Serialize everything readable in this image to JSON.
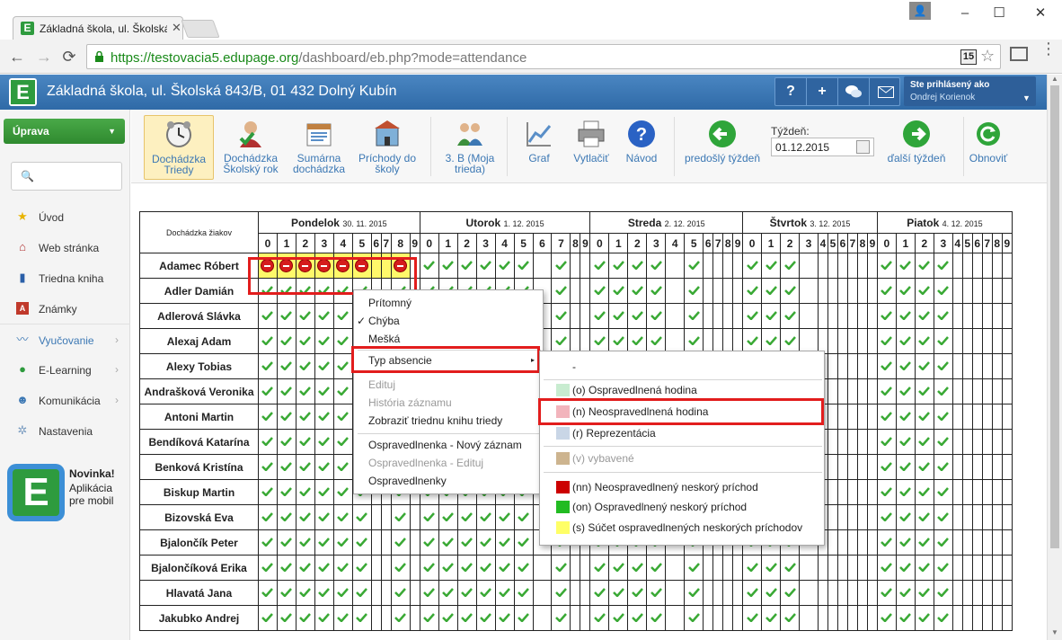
{
  "browser": {
    "tab_title": "Základná škola, ul. Školská",
    "favicon": "E",
    "url_scheme": "https://",
    "url_host": "testovacia5.edupage.org",
    "url_path": "/dashboard/eb.php?mode=attendance",
    "extension_badge": "15",
    "window_controls": [
      "–",
      "☐",
      "✕"
    ]
  },
  "app": {
    "logo": "E",
    "school_name": "Základná škola, ul. Školská 843/B, 01 432 Dolný Kubín",
    "header_buttons": [
      "?",
      "+",
      "",
      ""
    ],
    "user_label": "Ste prihlásený ako",
    "user_name": "Ondrej Korienok"
  },
  "sidebar": {
    "action_button": "Úprava",
    "search_placeholder": "",
    "items": [
      {
        "label": "Úvod",
        "icon": "star-icon",
        "group": false
      },
      {
        "label": "Web stránka",
        "icon": "web-icon",
        "group": false
      },
      {
        "label": "Triedna kniha",
        "icon": "book-icon",
        "group": false
      },
      {
        "label": "Známky",
        "icon": "grades-icon",
        "group": false
      },
      {
        "label": "Vyučovanie",
        "icon": "teaching-icon",
        "group": true
      },
      {
        "label": "E-Learning",
        "icon": "elearning-icon",
        "group": true
      },
      {
        "label": "Komunikácia",
        "icon": "communication-icon",
        "group": true
      },
      {
        "label": "Nastavenia",
        "icon": "settings-icon",
        "group": false
      }
    ],
    "promo_title": "Novinka!",
    "promo_text": "Aplikácia pre mobil"
  },
  "ribbon": {
    "buttons": [
      {
        "label": "Dochádzka Triedy",
        "icon": "clock-icon",
        "active": true
      },
      {
        "label": "Dochádzka Školský rok",
        "icon": "person-check-icon",
        "active": false
      },
      {
        "label": "Sumárna dochádzka",
        "icon": "summary-icon",
        "active": false
      },
      {
        "label": "Príchody do školy",
        "icon": "arrivals-icon",
        "active": false
      },
      {
        "label": "3. B (Moja trieda)",
        "icon": "class-icon",
        "active": false
      },
      {
        "label": "Graf",
        "icon": "chart-icon",
        "active": false
      },
      {
        "label": "Vytlačiť",
        "icon": "print-icon",
        "active": false
      },
      {
        "label": "Návod",
        "icon": "help-icon",
        "active": false
      },
      {
        "label": "predošlý týždeň",
        "icon": "arrow-left-icon",
        "active": false
      },
      {
        "label": "ďalší týždeň",
        "icon": "arrow-right-icon",
        "active": false
      },
      {
        "label": "Obnoviť",
        "icon": "refresh-icon",
        "active": false
      }
    ],
    "week_label": "Týždeň:",
    "week_value": "01.12.2015"
  },
  "attendance": {
    "corner_label": "Dochádzka žiakov",
    "days": [
      {
        "name": "Pondelok",
        "date": "30. 11. 2015",
        "lessons": [
          "0",
          "1",
          "2",
          "3",
          "4",
          "5",
          "6",
          "7",
          "8",
          "9"
        ]
      },
      {
        "name": "Utorok",
        "date": "1. 12. 2015",
        "lessons": [
          "0",
          "1",
          "2",
          "3",
          "4",
          "5",
          "6",
          "7",
          "8",
          "9"
        ]
      },
      {
        "name": "Streda",
        "date": "2. 12. 2015",
        "lessons": [
          "0",
          "1",
          "2",
          "3",
          "4",
          "5",
          "6",
          "7",
          "8",
          "9"
        ]
      },
      {
        "name": "Štvrtok",
        "date": "3. 12. 2015",
        "lessons": [
          "0",
          "1",
          "2",
          "3",
          "4",
          "5",
          "6",
          "7",
          "8",
          "9"
        ]
      },
      {
        "name": "Piatok",
        "date": "4. 12. 2015",
        "lessons": [
          "0",
          "1",
          "2",
          "3",
          "4",
          "5",
          "6",
          "7",
          "8",
          "9"
        ]
      }
    ],
    "students": [
      "Adamec Róbert",
      "Adler Damián",
      "Adlerová Slávka",
      "Alexaj Adam",
      "Alexy Tobias",
      "Andrašková Veronika",
      "Antoni Martin",
      "Bendíková Katarína",
      "Benková Kristína",
      "Biskup Martin",
      "Bizovská Eva",
      "Bjalončík Peter",
      "Bjalončíková Erika",
      "Hlavatá Jana",
      "Jakubko Andrej"
    ]
  },
  "context_menu": {
    "items": [
      {
        "label": "Prítomný",
        "checked": false,
        "disabled": false
      },
      {
        "label": "Chýba",
        "checked": true,
        "disabled": false
      },
      {
        "label": "Mešká",
        "checked": false,
        "disabled": false
      },
      {
        "label": "Typ absencie",
        "checked": false,
        "disabled": false,
        "submenu": true
      },
      {
        "label": "Edituj",
        "checked": false,
        "disabled": true
      },
      {
        "label": "História záznamu",
        "checked": false,
        "disabled": true
      },
      {
        "label": "Zobraziť triednu knihu triedy",
        "checked": false,
        "disabled": false
      },
      {
        "label": "Ospravedlnenka - Nový záznam",
        "checked": false,
        "disabled": false
      },
      {
        "label": "Ospravedlnenka - Edituj",
        "checked": false,
        "disabled": true
      },
      {
        "label": "Ospravedlnenky",
        "checked": false,
        "disabled": false
      }
    ],
    "check_glyph": "✓",
    "submenu_arrow": "▸"
  },
  "absence_submenu": {
    "items": [
      {
        "label": "-",
        "color": "",
        "disabled": false
      },
      {
        "label": "(o) Ospravedlnená hodina",
        "color": "#c8ecd0",
        "disabled": false
      },
      {
        "label": "(n) Neospravedlnená hodina",
        "color": "#f2b4bc",
        "disabled": false
      },
      {
        "label": "(r) Reprezentácia",
        "color": "#c9d6e6",
        "disabled": false
      },
      {
        "label": "(v) vybavené",
        "color": "#cdb48f",
        "disabled": true
      },
      {
        "label": "(nn) Neospravedlnený neskorý príchod",
        "color": "#cc0000",
        "disabled": false
      },
      {
        "label": "(on) Ospravedlnený neskorý príchod",
        "color": "#22bb22",
        "disabled": false
      },
      {
        "label": "(s) Súčet ospravedlnených neskorých príchodov",
        "color": "#ffff66",
        "disabled": false
      }
    ]
  },
  "colors": {
    "header_blue": "#3c78b4",
    "brand_green": "#2e9b3e",
    "highlight_red": "#e21d1d",
    "absent_yellow": "#fff86a",
    "check_green": "#3aa935"
  }
}
